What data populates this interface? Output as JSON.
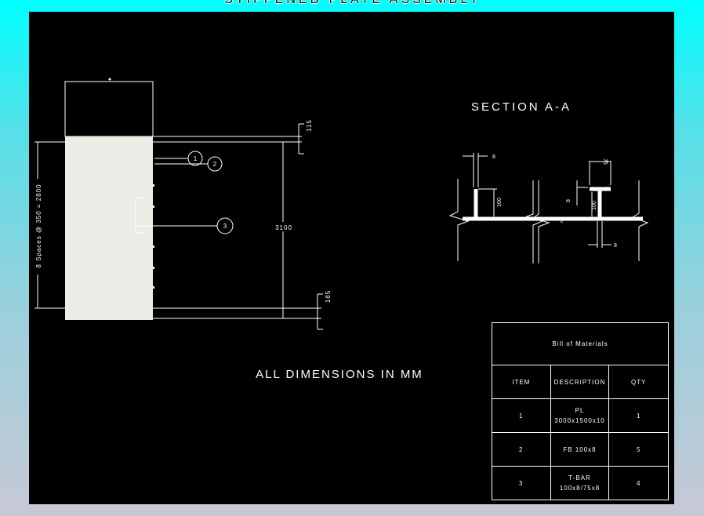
{
  "title": "STIFFENED PLATE ASSEMBLY",
  "section_title": "SECTION A-A",
  "note": "ALL DIMENSIONS IN MM",
  "plan_dims": {
    "top": "115",
    "bottom": "185",
    "overall": "3100",
    "spacing": "8 Spaces @ 350 = 2800"
  },
  "callouts": [
    "1",
    "2",
    "3"
  ],
  "section_dims": {
    "fb_thickness": "8",
    "fb_height": "100",
    "tbar_flange": "75",
    "tbar_flange_thk": "8",
    "tbar_height": "100",
    "tbar_web_thk": "8"
  },
  "bom": {
    "title": "Bill of Materials",
    "headers": [
      "ITEM",
      "DESCRIPTION",
      "QTY"
    ],
    "rows": [
      {
        "item": "1",
        "desc_line1": "PL",
        "desc_line2": "3000x1500x10",
        "qty": "1"
      },
      {
        "item": "2",
        "desc_line1": "FB 100x8",
        "desc_line2": "",
        "qty": "5"
      },
      {
        "item": "3",
        "desc_line1": "T-BAR",
        "desc_line2": "100x8/75x8",
        "qty": "4"
      }
    ]
  },
  "colors": {
    "background_top": "#00ffff",
    "sheet": "#000000",
    "plate": "#ececE6",
    "lines": "#ffffff"
  }
}
